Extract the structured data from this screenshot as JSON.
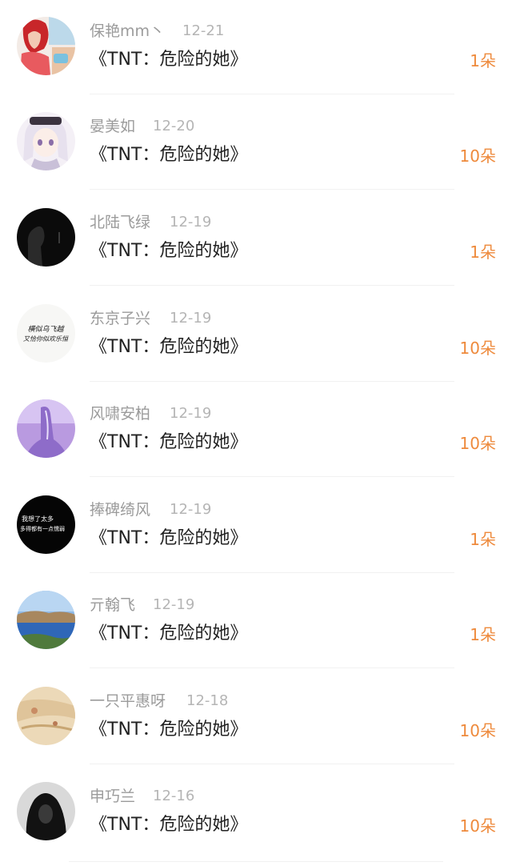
{
  "gift_list": {
    "items": [
      {
        "name": "保艳mm丶",
        "date": "12-21",
        "title": "《TNT：危险的她》",
        "gift": "1朵",
        "avatar": "avatar-red-hair-girl"
      },
      {
        "name": "晏美如",
        "date": "12-20",
        "title": "《TNT：危险的她》",
        "gift": "10朵",
        "avatar": "avatar-anime-girl"
      },
      {
        "name": "北陆飞绿",
        "date": "12-19",
        "title": "《TNT：危险的她》",
        "gift": "1朵",
        "avatar": "avatar-dark-silhouette"
      },
      {
        "name": "东京子兴",
        "date": "12-19",
        "title": "《TNT：危险的她》",
        "gift": "10朵",
        "avatar": "avatar-calligraphy"
      },
      {
        "name": "风啸安柏",
        "date": "12-19",
        "title": "《TNT：危险的她》",
        "gift": "10朵",
        "avatar": "avatar-purple-figure"
      },
      {
        "name": "捧碑绮风",
        "date": "12-19",
        "title": "《TNT：危险的她》",
        "gift": "1朵",
        "avatar": "avatar-black-text"
      },
      {
        "name": "亓翰飞",
        "date": "12-19",
        "title": "《TNT：危险的她》",
        "gift": "1朵",
        "avatar": "avatar-lake-landscape"
      },
      {
        "name": "一只平惠呀",
        "date": "12-18",
        "title": "《TNT：危险的她》",
        "gift": "10朵",
        "avatar": "avatar-painting"
      },
      {
        "name": "申巧兰",
        "date": "12-16",
        "title": "《TNT：危险的她》",
        "gift": "10朵",
        "avatar": "avatar-hooded-person"
      }
    ],
    "avatar_texts": {
      "calligraphy_line1": "横似乌飞越",
      "calligraphy_line2": "又恰你似欢乐恒",
      "black_line1": "我想了太多",
      "black_line2": "多得都有一点懦弱"
    },
    "colors": {
      "name": "#9b9b9b",
      "date": "#b5b5b5",
      "title": "#222222",
      "gift": "#ee8a3c"
    }
  }
}
